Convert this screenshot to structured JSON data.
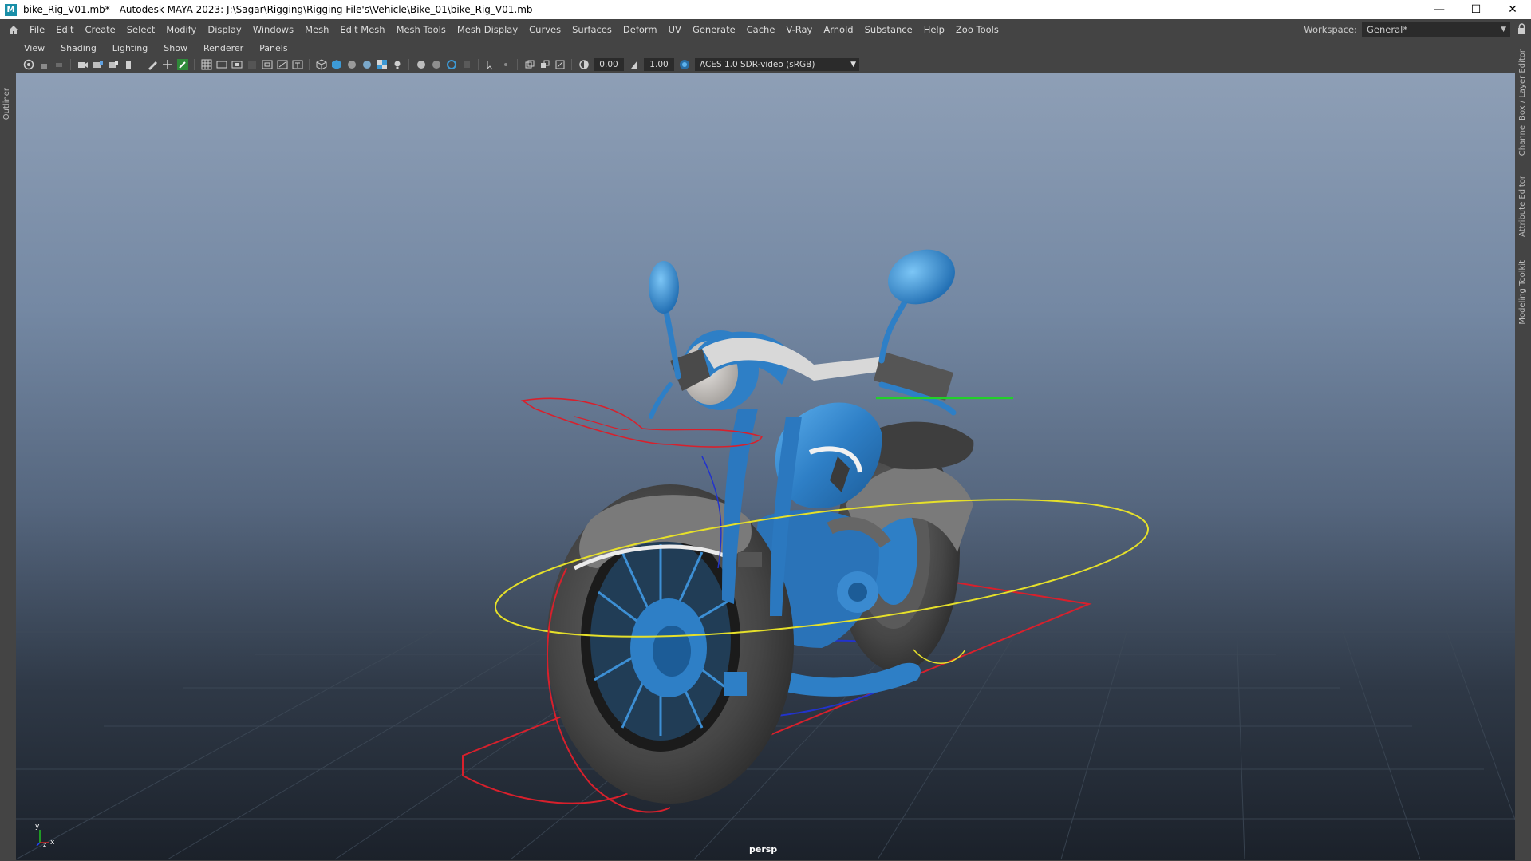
{
  "window": {
    "title": "bike_Rig_V01.mb* - Autodesk MAYA 2023: J:\\Sagar\\Rigging\\Rigging File's\\Vehicle\\Bike_01\\bike_Rig_V01.mb",
    "app_icon_letter": "M"
  },
  "menubar": {
    "items": [
      "File",
      "Edit",
      "Create",
      "Select",
      "Modify",
      "Display",
      "Windows",
      "Mesh",
      "Edit Mesh",
      "Mesh Tools",
      "Mesh Display",
      "Curves",
      "Surfaces",
      "Deform",
      "UV",
      "Generate",
      "Cache",
      "V-Ray",
      "Arnold",
      "Substance",
      "Help",
      "Zoo Tools"
    ],
    "workspace_label": "Workspace:",
    "workspace_value": "General*"
  },
  "side_tabs": {
    "left": "Outliner",
    "right": [
      "Channel Box / Layer Editor",
      "Attribute Editor",
      "Modeling Toolkit"
    ]
  },
  "panel_menu": [
    "View",
    "Shading",
    "Lighting",
    "Show",
    "Renderer",
    "Panels"
  ],
  "panel_toolbar": {
    "exposure": "0.00",
    "gamma": "1.00",
    "color_space": "ACES 1.0 SDR-video (sRGB)"
  },
  "viewport": {
    "camera": "persp",
    "axis_labels": {
      "y": "y",
      "x": "x",
      "z": "z"
    }
  },
  "colors": {
    "ui_bg": "#444444",
    "field_bg": "#2b2b2b",
    "bike_blue": "#2f7fc4",
    "tire_gray": "#4a4a4a",
    "ctrl_red": "#d8202c",
    "ctrl_yellow": "#e6e02a",
    "ctrl_green": "#22d02a",
    "ctrl_blue": "#2233cc"
  }
}
